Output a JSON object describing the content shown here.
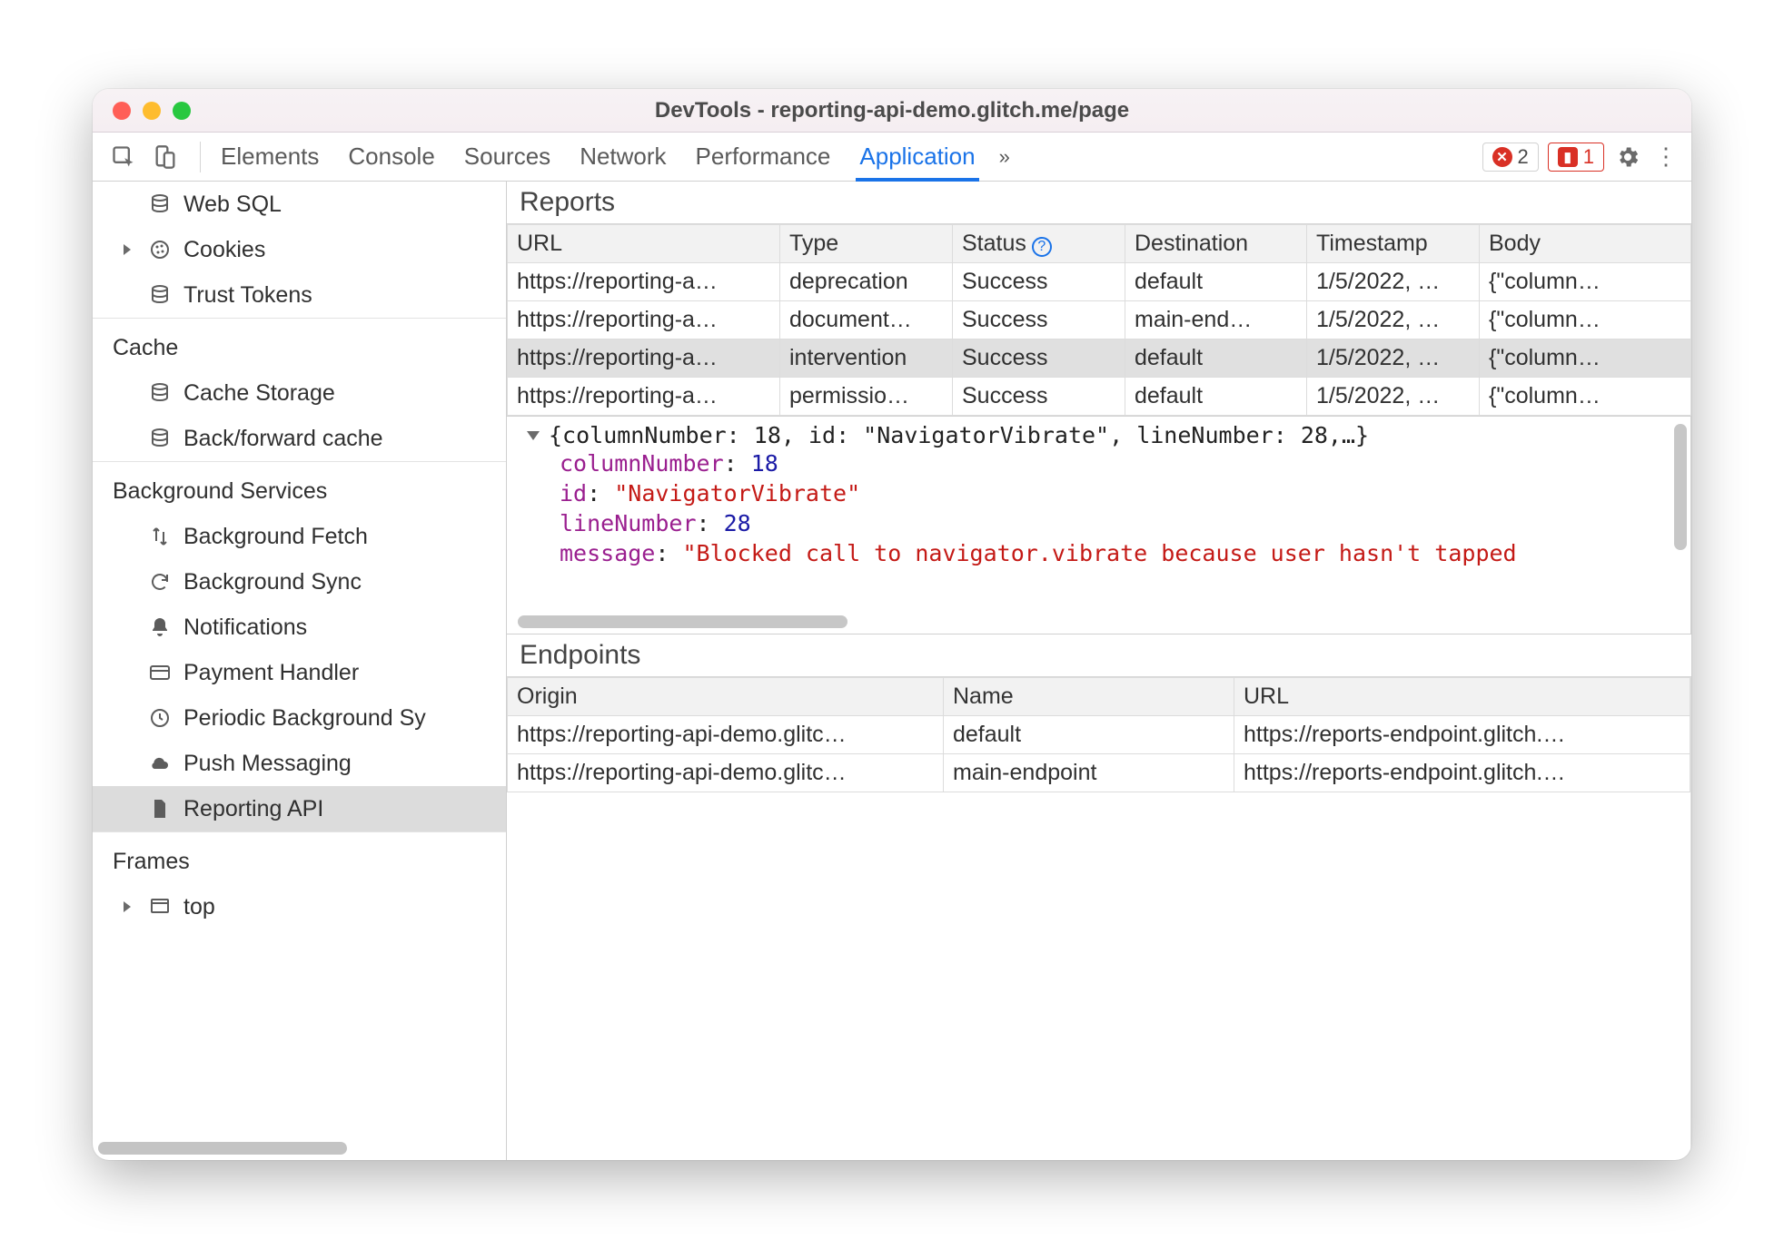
{
  "window": {
    "title": "DevTools - reporting-api-demo.glitch.me/page"
  },
  "toolbar": {
    "tabs": [
      "Elements",
      "Console",
      "Sources",
      "Network",
      "Performance",
      "Application"
    ],
    "active_tab": "Application",
    "errors_count": "2",
    "issues_count": "1"
  },
  "sidebar": {
    "pre_items": [
      {
        "label": "Web SQL",
        "icon": "database-icon"
      },
      {
        "label": "Cookies",
        "icon": "cookie-icon",
        "expandable": true
      },
      {
        "label": "Trust Tokens",
        "icon": "database-icon"
      }
    ],
    "sections": [
      {
        "title": "Cache",
        "items": [
          {
            "label": "Cache Storage",
            "icon": "database-icon"
          },
          {
            "label": "Back/forward cache",
            "icon": "database-icon"
          }
        ]
      },
      {
        "title": "Background Services",
        "items": [
          {
            "label": "Background Fetch",
            "icon": "updown-icon"
          },
          {
            "label": "Background Sync",
            "icon": "sync-icon"
          },
          {
            "label": "Notifications",
            "icon": "bell-icon"
          },
          {
            "label": "Payment Handler",
            "icon": "card-icon"
          },
          {
            "label": "Periodic Background Sy",
            "icon": "clock-icon"
          },
          {
            "label": "Push Messaging",
            "icon": "cloud-icon"
          },
          {
            "label": "Reporting API",
            "icon": "file-icon",
            "selected": true
          }
        ]
      },
      {
        "title": "Frames",
        "items": [
          {
            "label": "top",
            "icon": "frame-icon",
            "expandable": true
          }
        ]
      }
    ]
  },
  "reports": {
    "title": "Reports",
    "columns": [
      "URL",
      "Type",
      "Status",
      "Destination",
      "Timestamp",
      "Body"
    ],
    "status_help": true,
    "rows": [
      {
        "url": "https://reporting-a…",
        "type": "deprecation",
        "status": "Success",
        "dest": "default",
        "ts": "1/5/2022, …",
        "body": "{\"column…",
        "selected": false
      },
      {
        "url": "https://reporting-a…",
        "type": "document…",
        "status": "Success",
        "dest": "main-end…",
        "ts": "1/5/2022, …",
        "body": "{\"column…",
        "selected": false
      },
      {
        "url": "https://reporting-a…",
        "type": "intervention",
        "status": "Success",
        "dest": "default",
        "ts": "1/5/2022, …",
        "body": "{\"column…",
        "selected": true
      },
      {
        "url": "https://reporting-a…",
        "type": "permissio…",
        "status": "Success",
        "dest": "default",
        "ts": "1/5/2022, …",
        "body": "{\"column…",
        "selected": false
      }
    ]
  },
  "detail": {
    "summary": "{columnNumber: 18, id: \"NavigatorVibrate\", lineNumber: 28,…}",
    "props": {
      "columnNumber": "18",
      "id": "\"NavigatorVibrate\"",
      "lineNumber": "28",
      "message": "\"Blocked call to navigator.vibrate because user hasn't tapped"
    }
  },
  "endpoints": {
    "title": "Endpoints",
    "columns": [
      "Origin",
      "Name",
      "URL"
    ],
    "rows": [
      {
        "origin": "https://reporting-api-demo.glitc…",
        "name": "default",
        "url": "https://reports-endpoint.glitch.…"
      },
      {
        "origin": "https://reporting-api-demo.glitc…",
        "name": "main-endpoint",
        "url": "https://reports-endpoint.glitch.…"
      }
    ]
  }
}
